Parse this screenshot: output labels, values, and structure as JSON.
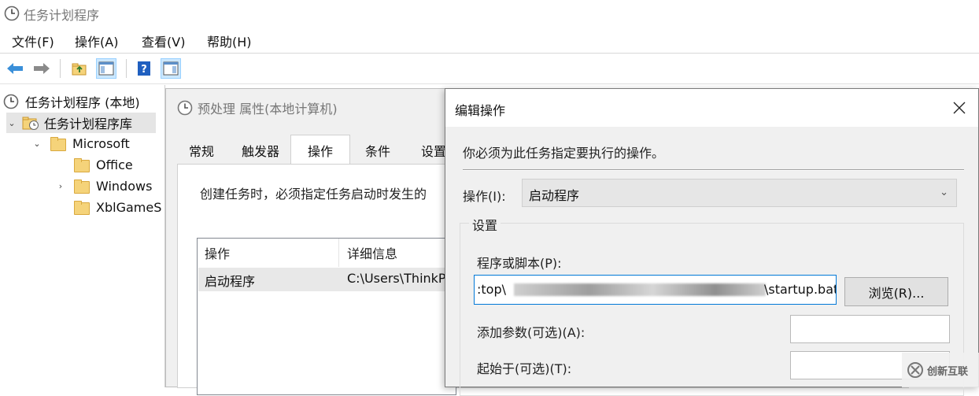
{
  "window": {
    "title": "任务计划程序"
  },
  "menu": [
    "文件(F)",
    "操作(A)",
    "查看(V)",
    "帮助(H)"
  ],
  "toolbar": {
    "buttons": [
      "back-arrow-icon",
      "forward-arrow-icon",
      "up-folder-icon",
      "show-hide-console-tree-icon",
      "help-icon",
      "show-hide-action-pane-icon"
    ]
  },
  "tree": {
    "root": "任务计划程序 (本地)",
    "library": "任务计划程序库",
    "microsoft": "Microsoft",
    "office": "Office",
    "windows": "Windows",
    "xbl": "XblGameS"
  },
  "properties": {
    "title": "预处理 属性(本地计算机)",
    "tabs": [
      "常规",
      "触发器",
      "操作",
      "条件",
      "设置"
    ],
    "selected_tab": "操作",
    "description": "创建任务时，必须指定任务启动时发生的",
    "table": {
      "headers": [
        "操作",
        "详细信息"
      ],
      "rows": [
        {
          "action": "启动程序",
          "details": "C:\\Users\\ThinkP"
        }
      ]
    }
  },
  "dialog": {
    "title": "编辑操作",
    "instruction": "你必须为此任务指定要执行的操作。",
    "action_label": "操作(I):",
    "action_value": "启动程序",
    "settings_label": "设置",
    "program_label": "程序或脚本(P):",
    "program_value_start": ":top\\",
    "program_value_end": "\\startup.bat",
    "browse_label": "浏览(R)...",
    "args_label": "添加参数(可选)(A):",
    "start_label": "起始于(可选)(T):"
  },
  "watermark": {
    "text": "创新互联"
  },
  "colors": {
    "accent": "#0078d7",
    "selection": "#cce8ff"
  }
}
